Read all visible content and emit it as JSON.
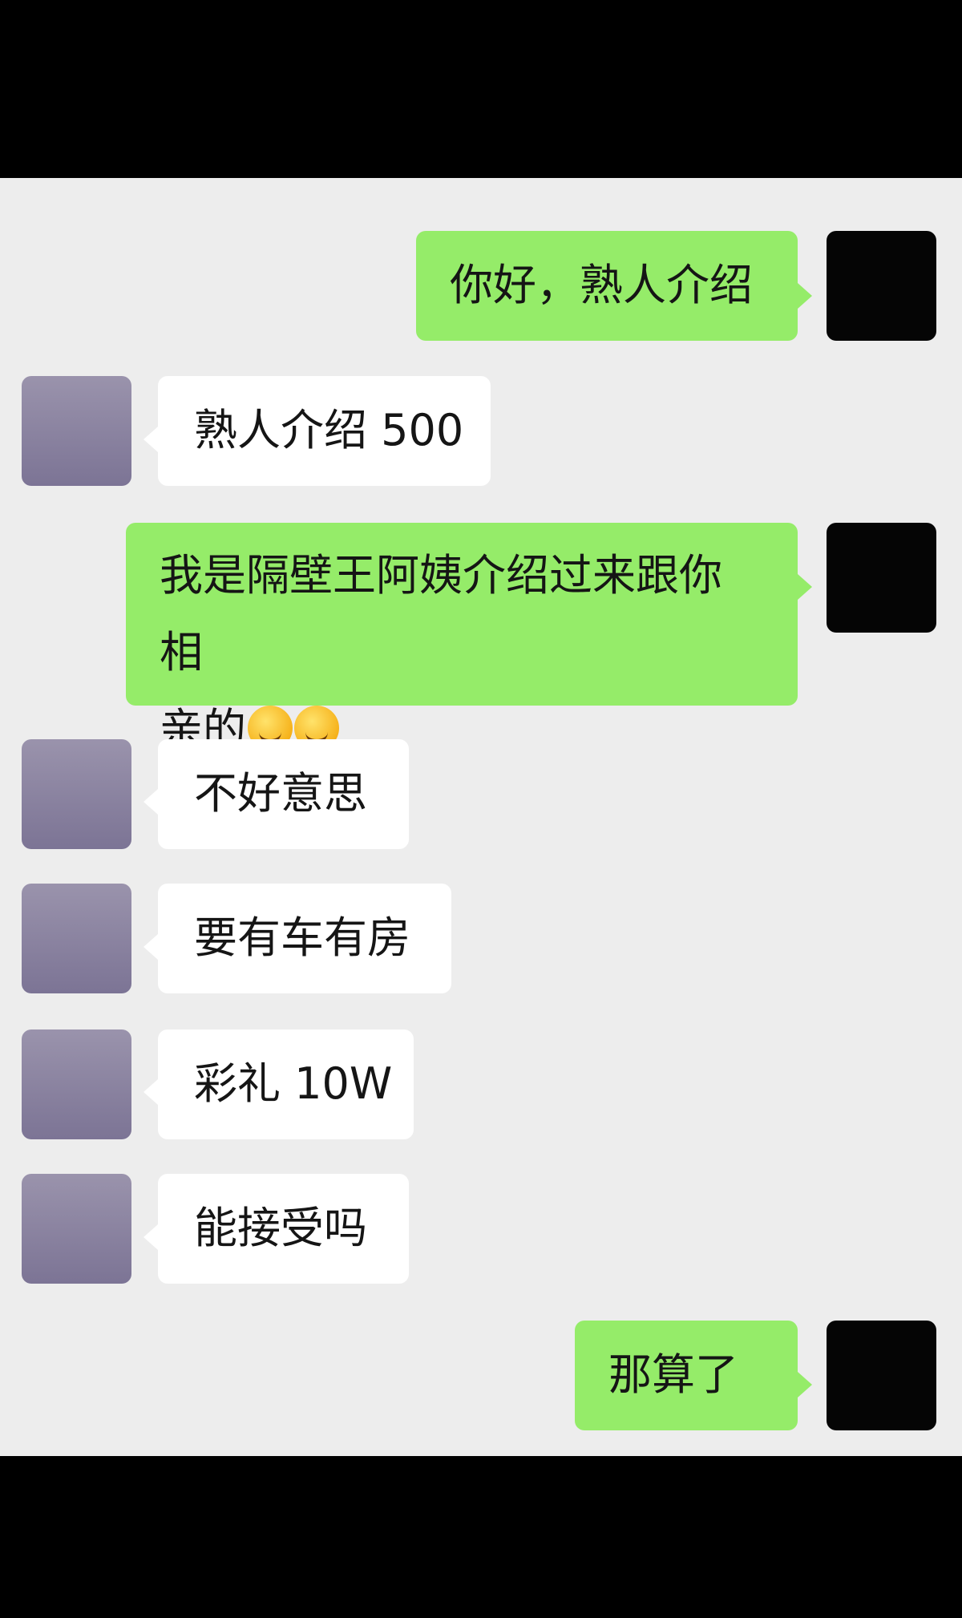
{
  "messages": [
    {
      "side": "self",
      "text": "你好，熟人介绍"
    },
    {
      "side": "other",
      "text": "熟人介绍 500"
    },
    {
      "side": "self",
      "text_line1": "我是隔壁王阿姨介绍过来跟你相",
      "text_line2": "亲的",
      "emoji": [
        "face-with-tears-of-joy",
        "face-with-tears-of-joy"
      ]
    },
    {
      "side": "other",
      "text": "不好意思"
    },
    {
      "side": "other",
      "text": "要有车有房"
    },
    {
      "side": "other",
      "text": "彩礼 10W"
    },
    {
      "side": "other",
      "text": "能接受吗"
    },
    {
      "side": "self",
      "text": "那算了"
    }
  ],
  "colors": {
    "self_bubble": "#95ec69",
    "other_bubble": "#ffffff",
    "chat_background": "#ededed"
  }
}
